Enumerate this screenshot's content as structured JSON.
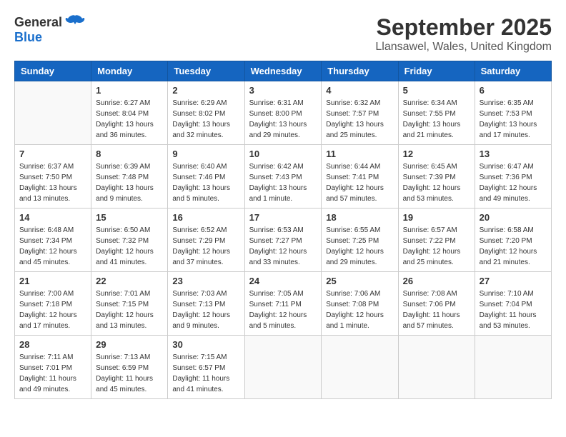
{
  "header": {
    "logo_general": "General",
    "logo_blue": "Blue",
    "month": "September 2025",
    "location": "Llansawel, Wales, United Kingdom"
  },
  "weekdays": [
    "Sunday",
    "Monday",
    "Tuesday",
    "Wednesday",
    "Thursday",
    "Friday",
    "Saturday"
  ],
  "weeks": [
    [
      {
        "day": "",
        "info": ""
      },
      {
        "day": "1",
        "info": "Sunrise: 6:27 AM\nSunset: 8:04 PM\nDaylight: 13 hours\nand 36 minutes."
      },
      {
        "day": "2",
        "info": "Sunrise: 6:29 AM\nSunset: 8:02 PM\nDaylight: 13 hours\nand 32 minutes."
      },
      {
        "day": "3",
        "info": "Sunrise: 6:31 AM\nSunset: 8:00 PM\nDaylight: 13 hours\nand 29 minutes."
      },
      {
        "day": "4",
        "info": "Sunrise: 6:32 AM\nSunset: 7:57 PM\nDaylight: 13 hours\nand 25 minutes."
      },
      {
        "day": "5",
        "info": "Sunrise: 6:34 AM\nSunset: 7:55 PM\nDaylight: 13 hours\nand 21 minutes."
      },
      {
        "day": "6",
        "info": "Sunrise: 6:35 AM\nSunset: 7:53 PM\nDaylight: 13 hours\nand 17 minutes."
      }
    ],
    [
      {
        "day": "7",
        "info": "Sunrise: 6:37 AM\nSunset: 7:50 PM\nDaylight: 13 hours\nand 13 minutes."
      },
      {
        "day": "8",
        "info": "Sunrise: 6:39 AM\nSunset: 7:48 PM\nDaylight: 13 hours\nand 9 minutes."
      },
      {
        "day": "9",
        "info": "Sunrise: 6:40 AM\nSunset: 7:46 PM\nDaylight: 13 hours\nand 5 minutes."
      },
      {
        "day": "10",
        "info": "Sunrise: 6:42 AM\nSunset: 7:43 PM\nDaylight: 13 hours\nand 1 minute."
      },
      {
        "day": "11",
        "info": "Sunrise: 6:44 AM\nSunset: 7:41 PM\nDaylight: 12 hours\nand 57 minutes."
      },
      {
        "day": "12",
        "info": "Sunrise: 6:45 AM\nSunset: 7:39 PM\nDaylight: 12 hours\nand 53 minutes."
      },
      {
        "day": "13",
        "info": "Sunrise: 6:47 AM\nSunset: 7:36 PM\nDaylight: 12 hours\nand 49 minutes."
      }
    ],
    [
      {
        "day": "14",
        "info": "Sunrise: 6:48 AM\nSunset: 7:34 PM\nDaylight: 12 hours\nand 45 minutes."
      },
      {
        "day": "15",
        "info": "Sunrise: 6:50 AM\nSunset: 7:32 PM\nDaylight: 12 hours\nand 41 minutes."
      },
      {
        "day": "16",
        "info": "Sunrise: 6:52 AM\nSunset: 7:29 PM\nDaylight: 12 hours\nand 37 minutes."
      },
      {
        "day": "17",
        "info": "Sunrise: 6:53 AM\nSunset: 7:27 PM\nDaylight: 12 hours\nand 33 minutes."
      },
      {
        "day": "18",
        "info": "Sunrise: 6:55 AM\nSunset: 7:25 PM\nDaylight: 12 hours\nand 29 minutes."
      },
      {
        "day": "19",
        "info": "Sunrise: 6:57 AM\nSunset: 7:22 PM\nDaylight: 12 hours\nand 25 minutes."
      },
      {
        "day": "20",
        "info": "Sunrise: 6:58 AM\nSunset: 7:20 PM\nDaylight: 12 hours\nand 21 minutes."
      }
    ],
    [
      {
        "day": "21",
        "info": "Sunrise: 7:00 AM\nSunset: 7:18 PM\nDaylight: 12 hours\nand 17 minutes."
      },
      {
        "day": "22",
        "info": "Sunrise: 7:01 AM\nSunset: 7:15 PM\nDaylight: 12 hours\nand 13 minutes."
      },
      {
        "day": "23",
        "info": "Sunrise: 7:03 AM\nSunset: 7:13 PM\nDaylight: 12 hours\nand 9 minutes."
      },
      {
        "day": "24",
        "info": "Sunrise: 7:05 AM\nSunset: 7:11 PM\nDaylight: 12 hours\nand 5 minutes."
      },
      {
        "day": "25",
        "info": "Sunrise: 7:06 AM\nSunset: 7:08 PM\nDaylight: 12 hours\nand 1 minute."
      },
      {
        "day": "26",
        "info": "Sunrise: 7:08 AM\nSunset: 7:06 PM\nDaylight: 11 hours\nand 57 minutes."
      },
      {
        "day": "27",
        "info": "Sunrise: 7:10 AM\nSunset: 7:04 PM\nDaylight: 11 hours\nand 53 minutes."
      }
    ],
    [
      {
        "day": "28",
        "info": "Sunrise: 7:11 AM\nSunset: 7:01 PM\nDaylight: 11 hours\nand 49 minutes."
      },
      {
        "day": "29",
        "info": "Sunrise: 7:13 AM\nSunset: 6:59 PM\nDaylight: 11 hours\nand 45 minutes."
      },
      {
        "day": "30",
        "info": "Sunrise: 7:15 AM\nSunset: 6:57 PM\nDaylight: 11 hours\nand 41 minutes."
      },
      {
        "day": "",
        "info": ""
      },
      {
        "day": "",
        "info": ""
      },
      {
        "day": "",
        "info": ""
      },
      {
        "day": "",
        "info": ""
      }
    ]
  ]
}
